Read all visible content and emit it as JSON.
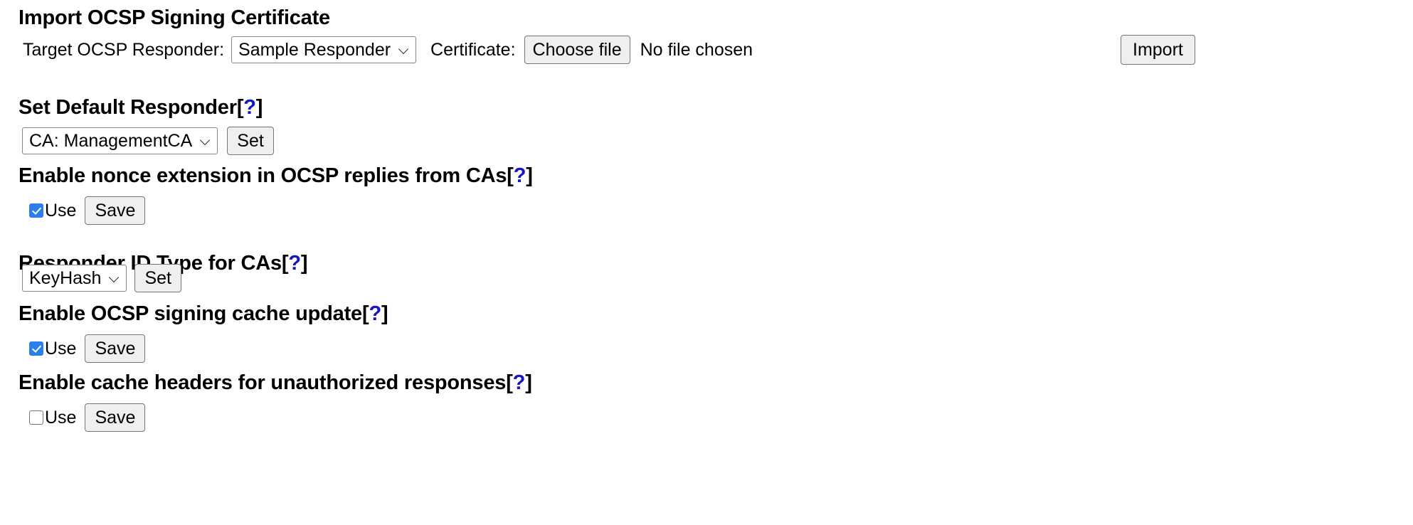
{
  "page": {
    "background": "#ffffff",
    "accent_help_color": "#1414c8",
    "checkbox_checked_color": "#2a7fee",
    "button_face_color": "#efefef"
  },
  "sections": {
    "import_certificate": {
      "heading": "Import OCSP Signing Certificate",
      "has_help": false,
      "responder_label": "Target OCSP Responder:",
      "responder_select": {
        "name": "target-ocsp-responder-select",
        "selected": "Sample Responder",
        "options": [
          "Sample Responder"
        ]
      },
      "certificate_label": "Certificate:",
      "choose_file_button": "Choose file",
      "file_status": "No file chosen",
      "import_button": "Import"
    },
    "default_responder": {
      "heading": "Set Default Responder",
      "help_open": "[",
      "help_q": "?",
      "help_close": "]",
      "select": {
        "name": "default-responder-select",
        "selected": "CA: ManagementCA",
        "options": [
          "CA: ManagementCA"
        ]
      },
      "set_button": "Set"
    },
    "nonce_extension": {
      "heading": "Enable nonce extension in OCSP replies from CAs",
      "use_label": "Use",
      "checked": true,
      "save_button": "Save"
    },
    "responder_id_type": {
      "heading": "Responder ID Type for CAs",
      "select": {
        "name": "responder-id-type-select",
        "selected": "KeyHash",
        "options": [
          "KeyHash"
        ]
      },
      "set_button": "Set"
    },
    "signing_cache_update": {
      "heading": "Enable OCSP signing cache update",
      "use_label": "Use",
      "checked": true,
      "save_button": "Save"
    },
    "cache_headers_unauthorized": {
      "heading": "Enable cache headers for unauthorized responses",
      "use_label": "Use",
      "checked": false,
      "save_button": "Save"
    }
  },
  "icons": {
    "chevron_down": "chevron-down-icon",
    "checkmark": "checkmark-icon"
  }
}
